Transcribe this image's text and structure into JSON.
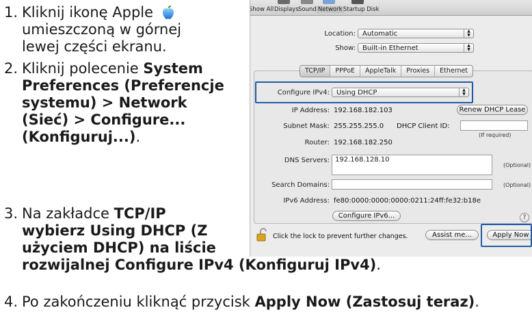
{
  "steps": [
    {
      "num": "1.",
      "lines": [
        "Kliknij ikonę Apple",
        "umieszczoną w górnej",
        "lewej części ekranu."
      ]
    },
    {
      "num": "2.",
      "bold_lines": [
        "Kliknij polecenie",
        "System",
        "Preferences (Preferencje",
        "systemu) > Network",
        "(Sieć) > Configure...",
        "(Konfiguruj...)",
        "."
      ]
    },
    {
      "num": "3.",
      "parts": [
        "Na zakładce",
        "TCP/IP",
        "wybierz Using DHCP (Z",
        "użyciem DHCP) na liście",
        "rozwijalnej Configure IPv4 (Konfiguruj IPv4)",
        "."
      ]
    },
    {
      "num": "4.",
      "parts": [
        "Po zakończeniu kliknąć przycisk",
        "Apply Now (Zastosuj teraz)",
        "."
      ]
    }
  ],
  "toolbar": {
    "items": [
      "Show All",
      "Displays",
      "Sound",
      "Network",
      "Startup Disk"
    ],
    "active": "Network"
  },
  "location": {
    "label": "Location:",
    "value": "Automatic"
  },
  "show": {
    "label": "Show:",
    "value": "Built-in Ethernet"
  },
  "tabs": [
    "TCP/IP",
    "PPPoE",
    "AppleTalk",
    "Proxies",
    "Ethernet"
  ],
  "active_tab": "TCP/IP",
  "configure": {
    "label": "Configure IPv4:",
    "value": "Using DHCP"
  },
  "ip": {
    "label": "IP Address:",
    "value": "192.168.182.103",
    "button": "Renew DHCP Lease"
  },
  "subnet": {
    "label": "Subnet Mask:",
    "value": "255.255.255.0",
    "client_id_label": "DHCP Client ID:",
    "client_id_hint": "(If required)"
  },
  "router": {
    "label": "Router:",
    "value": "192.168.182.250"
  },
  "dns": {
    "label": "DNS Servers:",
    "value": "192.168.128.10",
    "hint": "(Optional)"
  },
  "search": {
    "label": "Search Domains:",
    "value": "",
    "hint": "(Optional)"
  },
  "ipv6": {
    "label": "IPv6 Address:",
    "value": "fe80:0000:0000:0000:0211:24ff:fe32:b18e",
    "button": "Configure IPv6..."
  },
  "help": "?",
  "lock_text": "Click the lock to prevent further changes.",
  "assist_button": "Assist me...",
  "apply_button": "Apply Now",
  "highlight_color": "#1f5aa6"
}
